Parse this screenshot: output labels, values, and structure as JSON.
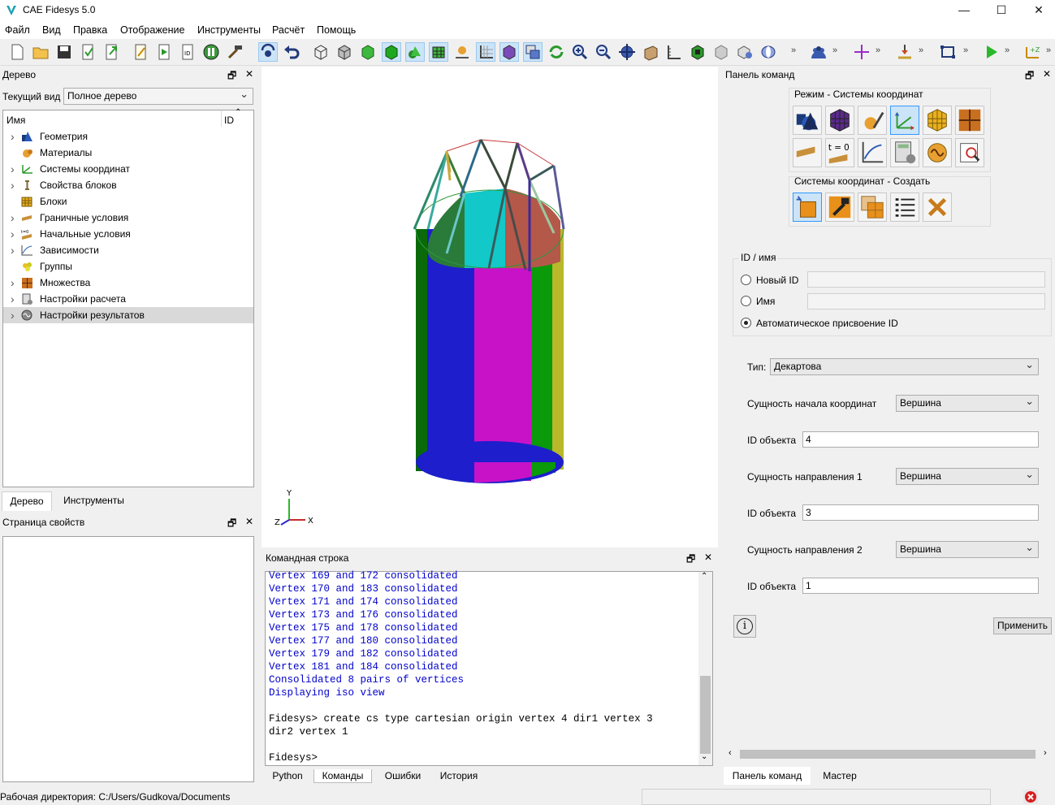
{
  "window": {
    "title": "CAE Fidesys 5.0",
    "minimize": "—",
    "maximize": "☐",
    "close": "✕"
  },
  "menu": [
    "Файл",
    "Вид",
    "Правка",
    "Отображение",
    "Инструменты",
    "Расчёт",
    "Помощь"
  ],
  "tree_panel": {
    "title": "Дерево",
    "view_label": "Текущий вид",
    "view_value": "Полное дерево",
    "col_name": "Имя",
    "col_id": "ID",
    "items": [
      {
        "label": "Геометрия",
        "icon": "geometry-icon",
        "expandable": true
      },
      {
        "label": "Материалы",
        "icon": "materials-icon",
        "expandable": false
      },
      {
        "label": "Системы координат",
        "icon": "coord-systems-icon",
        "expandable": true
      },
      {
        "label": "Свойства блоков",
        "icon": "block-properties-icon",
        "expandable": true
      },
      {
        "label": "Блоки",
        "icon": "blocks-icon",
        "expandable": false
      },
      {
        "label": "Граничные условия",
        "icon": "boundary-conditions-icon",
        "expandable": true
      },
      {
        "label": "Начальные условия",
        "icon": "initial-conditions-icon",
        "expandable": true
      },
      {
        "label": "Зависимости",
        "icon": "dependencies-icon",
        "expandable": true
      },
      {
        "label": "Группы",
        "icon": "groups-icon",
        "expandable": false
      },
      {
        "label": "Множества",
        "icon": "sets-icon",
        "expandable": true
      },
      {
        "label": "Настройки расчета",
        "icon": "calc-settings-icon",
        "expandable": true
      },
      {
        "label": "Настройки результатов",
        "icon": "result-settings-icon",
        "expandable": true,
        "selected": true
      }
    ],
    "tabs": [
      "Дерево",
      "Инструменты"
    ]
  },
  "properties_panel": {
    "title": "Страница свойств"
  },
  "command_line": {
    "title": "Командная строка",
    "lines": [
      "Vertex 169 and 172 consolidated",
      "Vertex 170 and 183 consolidated",
      "Vertex 171 and 174 consolidated",
      "Vertex 173 and 176 consolidated",
      "Vertex 175 and 178 consolidated",
      "Vertex 177 and 180 consolidated",
      "Vertex 179 and 182 consolidated",
      "Vertex 181 and 184 consolidated",
      "Consolidated 8 pairs of vertices",
      "Displaying iso view"
    ],
    "command_line1": "Fidesys> create cs type cartesian origin vertex 4 dir1 vertex 3",
    "command_line2": "dir2 vertex 1",
    "prompt": "Fidesys>",
    "tabs": [
      "Python",
      "Команды",
      "Ошибки",
      "История"
    ]
  },
  "command_panel": {
    "title": "Панель команд",
    "mode_group": "Режим - Системы координат",
    "create_group": "Системы координат - Создать",
    "t0_label": "t = 0",
    "id_group": "ID / имя",
    "radio_new_id": "Новый ID",
    "radio_name": "Имя",
    "radio_auto": "Автоматическое присвоение ID",
    "type_label": "Тип:",
    "type_value": "Декартова",
    "origin_label": "Сущность начала координат",
    "origin_value": "Вершина",
    "obj_id_label": "ID объекта",
    "origin_id": "4",
    "dir1_label": "Сущность направления 1",
    "dir1_value": "Вершина",
    "dir1_id": "3",
    "dir2_label": "Сущность направления 2",
    "dir2_value": "Вершина",
    "dir2_id": "1",
    "info_button": "i",
    "apply_button": "Применить",
    "tabs": [
      "Панель команд",
      "Мастер"
    ]
  },
  "viewport": {
    "axis_x": "X",
    "axis_y": "Y",
    "axis_z": "Z"
  },
  "status": {
    "working_dir": "Рабочая директория: C:/Users/Gudkova/Documents"
  }
}
